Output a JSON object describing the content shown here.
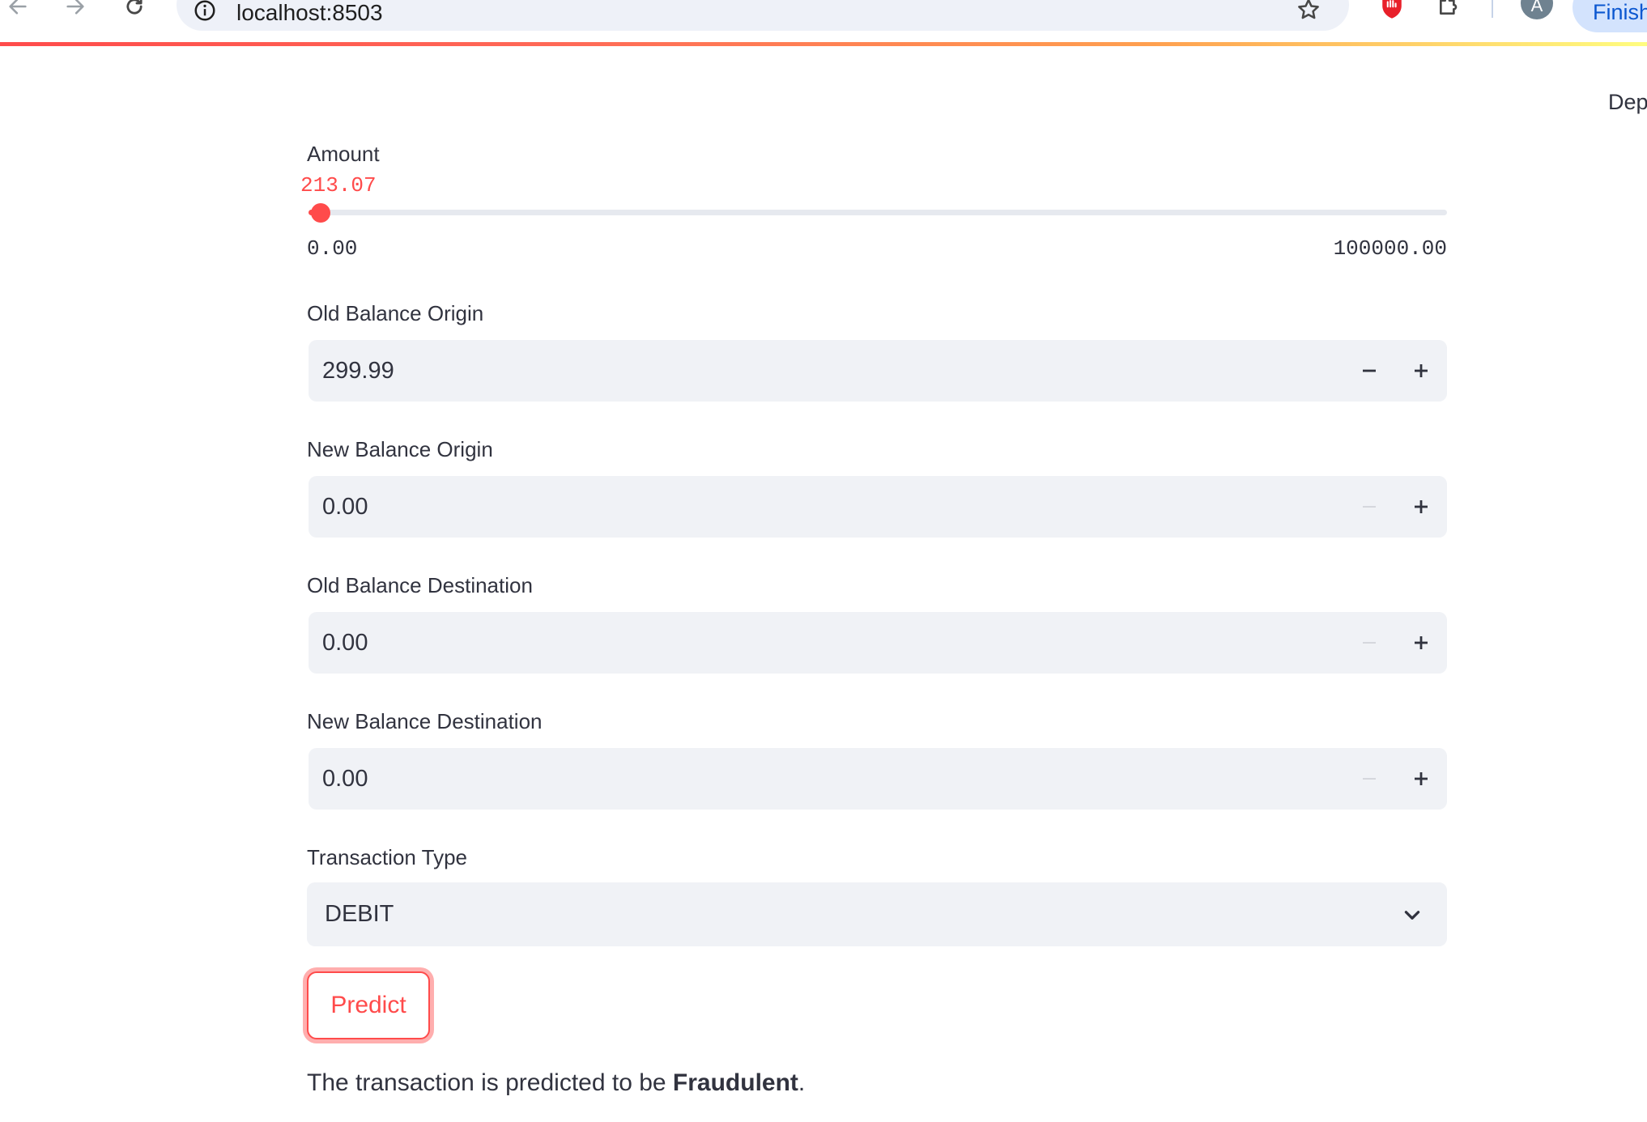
{
  "browser": {
    "url": "localhost:8503",
    "profile_initial": "A",
    "finish_label": "Finish",
    "icons": [
      "back-arrow-icon",
      "forward-arrow-icon",
      "reload-icon",
      "site-info-icon",
      "bookmark-star-icon",
      "adblock-extension-icon",
      "extensions-puzzle-icon"
    ]
  },
  "app_header": {
    "deploy_label": "Dep"
  },
  "form": {
    "amount": {
      "label": "Amount",
      "value": "213.07",
      "min": "0.00",
      "max": "100000.00",
      "fraction": 0.0021307
    },
    "old_balance_origin": {
      "label": "Old Balance Origin",
      "value": "299.99"
    },
    "new_balance_origin": {
      "label": "New Balance Origin",
      "value": "0.00"
    },
    "old_balance_destination": {
      "label": "Old Balance Destination",
      "value": "0.00"
    },
    "new_balance_destination": {
      "label": "New Balance Destination",
      "value": "0.00"
    },
    "transaction_type": {
      "label": "Transaction Type",
      "selected": "DEBIT"
    },
    "predict_label": "Predict"
  },
  "result": {
    "prefix": "The transaction is predicted to be ",
    "verdict": "Fraudulent",
    "suffix": "."
  },
  "colors": {
    "accent": "#ff4b4b",
    "input_bg": "#f0f2f6",
    "text": "#31333f"
  }
}
